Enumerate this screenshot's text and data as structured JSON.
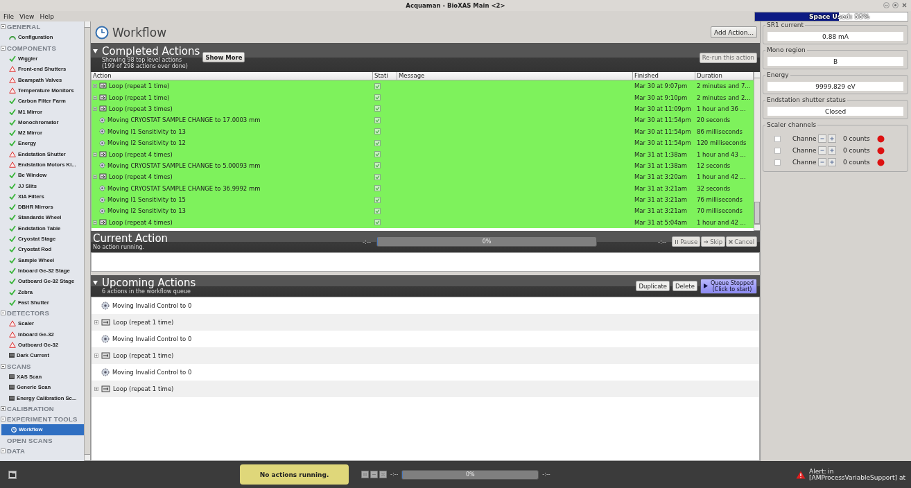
{
  "window": {
    "title": "Acquaman - BioXAS Main <2>"
  },
  "menu": [
    "File",
    "View",
    "Help"
  ],
  "space_used": {
    "label": "Space Used: 55%",
    "level": 0.55
  },
  "sidebar": {
    "sections": [
      {
        "label": "GENERAL",
        "has_children": true,
        "expanded": true,
        "items": [
          {
            "label": "Configuration",
            "kind": "config",
            "selected": false
          }
        ]
      },
      {
        "label": "COMPONENTS",
        "has_children": true,
        "expanded": true,
        "items": [
          {
            "label": "Wiggler",
            "kind": "ok",
            "selected": false
          },
          {
            "label": "Front-end Shutters",
            "kind": "warning",
            "selected": false
          },
          {
            "label": "Beampath Valves",
            "kind": "warning",
            "selected": false
          },
          {
            "label": "Temperature Monitors",
            "kind": "warning",
            "selected": false
          },
          {
            "label": "Carbon Filter Farm",
            "kind": "ok",
            "selected": false
          },
          {
            "label": "M1 Mirror",
            "kind": "ok",
            "selected": false
          },
          {
            "label": "Monochromator",
            "kind": "ok",
            "selected": false
          },
          {
            "label": "M2 Mirror",
            "kind": "ok",
            "selected": false
          },
          {
            "label": "Energy",
            "kind": "ok",
            "selected": false
          },
          {
            "label": "Endstation Shutter",
            "kind": "warning",
            "selected": false
          },
          {
            "label": "Endstation Motors Ki...",
            "kind": "warning",
            "selected": false
          },
          {
            "label": "Be Window",
            "kind": "ok",
            "selected": false
          },
          {
            "label": "JJ Slits",
            "kind": "ok",
            "selected": false
          },
          {
            "label": "XIA Filters",
            "kind": "ok",
            "selected": false
          },
          {
            "label": "DBHR Mirrors",
            "kind": "ok",
            "selected": false
          },
          {
            "label": "Standards Wheel",
            "kind": "ok",
            "selected": false
          },
          {
            "label": "Endstation Table",
            "kind": "ok",
            "selected": false
          },
          {
            "label": "Cryostat Stage",
            "kind": "ok",
            "selected": false
          },
          {
            "label": "Cryostat Rod",
            "kind": "ok",
            "selected": false
          },
          {
            "label": "Sample Wheel",
            "kind": "ok",
            "selected": false
          },
          {
            "label": "Inboard Ge-32 Stage",
            "kind": "ok",
            "selected": false
          },
          {
            "label": "Outboard Ge-32 Stage",
            "kind": "ok",
            "selected": false
          },
          {
            "label": "Zebra",
            "kind": "ok",
            "selected": false
          },
          {
            "label": "Fast Shutter",
            "kind": "ok",
            "selected": false
          }
        ]
      },
      {
        "label": "DETECTORS",
        "has_children": true,
        "expanded": true,
        "items": [
          {
            "label": "Scaler",
            "kind": "warning",
            "selected": false
          },
          {
            "label": "Inboard Ge-32",
            "kind": "warning",
            "selected": false
          },
          {
            "label": "Outboard Ge-32",
            "kind": "warning",
            "selected": false
          },
          {
            "label": "Dark Current",
            "kind": "scan",
            "selected": false
          }
        ]
      },
      {
        "label": "SCANS",
        "has_children": true,
        "expanded": true,
        "items": [
          {
            "label": "XAS Scan",
            "kind": "scan",
            "selected": false
          },
          {
            "label": "Generic Scan",
            "kind": "scan",
            "selected": false
          },
          {
            "label": "Energy Calibration Sc...",
            "kind": "scan",
            "selected": false
          }
        ]
      },
      {
        "label": "CALIBRATION",
        "has_children": true,
        "expanded": false
      },
      {
        "label": "EXPERIMENT TOOLS",
        "has_children": true,
        "expanded": true,
        "items": [
          {
            "label": "Workflow",
            "kind": "workflow",
            "selected": true
          }
        ]
      },
      {
        "label": "OPEN SCANS",
        "has_children": false
      },
      {
        "label": "DATA",
        "has_children": true,
        "expanded": true
      }
    ]
  },
  "workflow": {
    "title": "Workflow",
    "add_button": "Add Action..."
  },
  "completed": {
    "title": "Completed Actions",
    "subtitle_1": "Showing 98 top level actions",
    "subtitle_2": "(199 of 298 actions ever done)",
    "show_more": "Show More",
    "rerun": "Re-run this action",
    "rerun_disabled": true,
    "columns": [
      "Action",
      "Stati",
      "Message",
      "Finished",
      "Duration"
    ],
    "rows": [
      {
        "kind": "loop",
        "action": "Loop (repeat 1 time)",
        "succeeded": true,
        "finished": "Mar 30 at 9:07pm",
        "duration": "2 minutes and 7..."
      },
      {
        "kind": "loop",
        "action": "Loop (repeat 1 time)",
        "succeeded": true,
        "finished": "Mar 30 at 9:10pm",
        "duration": "2 minutes and 2..."
      },
      {
        "kind": "loop",
        "action": "Loop (repeat 3 times)",
        "succeeded": true,
        "finished": "Mar 30 at 11:09pm",
        "duration": "1 hour and 36 ..."
      },
      {
        "kind": "move",
        "action": "Moving CRYOSTAT SAMPLE CHANGE to 17.0003 mm",
        "succeeded": true,
        "finished": "Mar 30 at 11:54pm",
        "duration": "20 seconds"
      },
      {
        "kind": "move",
        "action": "Moving I1 Sensitivity to 13",
        "succeeded": true,
        "finished": "Mar 30 at 11:54pm",
        "duration": "86 milliseconds"
      },
      {
        "kind": "move",
        "action": "Moving I2 Sensitivity to 12",
        "succeeded": true,
        "finished": "Mar 30 at 11:54pm",
        "duration": "120 milliseconds"
      },
      {
        "kind": "loop",
        "action": "Loop (repeat 4 times)",
        "succeeded": true,
        "finished": "Mar 31 at 1:38am",
        "duration": "1 hour and 43 ..."
      },
      {
        "kind": "move",
        "action": "Moving CRYOSTAT SAMPLE CHANGE to 5.00093 mm",
        "succeeded": true,
        "finished": "Mar 31 at 1:38am",
        "duration": "12 seconds"
      },
      {
        "kind": "loop",
        "action": "Loop (repeat 4 times)",
        "succeeded": true,
        "finished": "Mar 31 at 3:20am",
        "duration": "1 hour and 42 ..."
      },
      {
        "kind": "move",
        "action": "Moving CRYOSTAT SAMPLE CHANGE to 36.9992 mm",
        "succeeded": true,
        "finished": "Mar 31 at 3:21am",
        "duration": "32 seconds"
      },
      {
        "kind": "move",
        "action": "Moving I1 Sensitivity to 15",
        "succeeded": true,
        "finished": "Mar 31 at 3:21am",
        "duration": "76 milliseconds"
      },
      {
        "kind": "move",
        "action": "Moving I2 Sensitivity to 13",
        "succeeded": true,
        "finished": "Mar 31 at 3:21am",
        "duration": "70 milliseconds"
      },
      {
        "kind": "loop",
        "action": "Loop (repeat 4 times)",
        "succeeded": true,
        "finished": "Mar 31 at 5:04am",
        "duration": "1 hour and 42 ..."
      }
    ]
  },
  "current": {
    "title": "Current Action",
    "subtitle": "No action running.",
    "elapsed": "-:--",
    "remaining": "-:--",
    "progress_label": "0%",
    "level": 0,
    "buttons": [
      {
        "kind": "pause",
        "label": "Pause",
        "disabled": true
      },
      {
        "kind": "skip",
        "label": "Skip",
        "disabled": true
      },
      {
        "kind": "cancel",
        "label": "Cancel",
        "disabled": true
      }
    ]
  },
  "upcoming": {
    "title": "Upcoming Actions",
    "subtitle": "6 actions in the workflow queue",
    "duplicate": "Duplicate",
    "delete": "Delete",
    "queue_line_1": "Queue Stopped",
    "queue_line_2": "(Click to start)",
    "items": [
      {
        "kind": "move",
        "label": "Moving Invalid Control to 0"
      },
      {
        "kind": "loop",
        "label": "Loop (repeat 1 time)"
      },
      {
        "kind": "move",
        "label": "Moving Invalid Control to 0"
      },
      {
        "kind": "loop",
        "label": "Loop (repeat 1 time)"
      },
      {
        "kind": "move",
        "label": "Moving Invalid Control to 0"
      },
      {
        "kind": "loop",
        "label": "Loop (repeat 1 time)"
      }
    ]
  },
  "status_panels": [
    {
      "title": "SR1 current",
      "value": "0.88 mA"
    },
    {
      "title": "Mono region",
      "value": "B"
    },
    {
      "title": "Energy",
      "value": "9999.829 eV"
    },
    {
      "title": "Endstation shutter status",
      "value": "Closed"
    }
  ],
  "scaler": {
    "title": "Scaler channels",
    "channels": [
      {
        "label": "Channe",
        "checked": false,
        "counts": "0 counts",
        "color": "#dd1111"
      },
      {
        "label": "Channe",
        "checked": false,
        "counts": "0 counts",
        "color": "#dd1111"
      },
      {
        "label": "Channe",
        "checked": false,
        "counts": "0 counts",
        "color": "#dd1111"
      }
    ]
  },
  "bottom": {
    "message": "No actions running.",
    "elapsed": "-:--",
    "remaining": "-:--",
    "progress_label": "0%",
    "level": 0,
    "alert_1": "Alert: in",
    "alert_2": "[AMProcessVariableSupport] at"
  }
}
